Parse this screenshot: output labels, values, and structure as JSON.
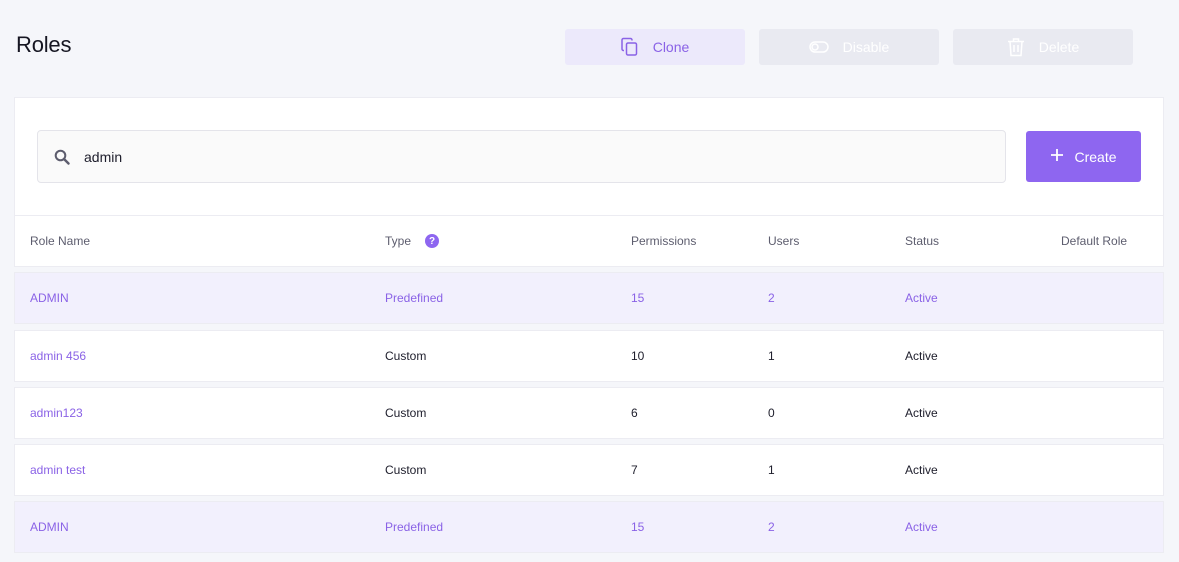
{
  "page": {
    "title": "Roles"
  },
  "actions": {
    "clone_label": "Clone",
    "disable_label": "Disable",
    "delete_label": "Delete"
  },
  "search": {
    "value": "admin",
    "icon": "search-icon"
  },
  "create": {
    "label": "Create",
    "icon": "plus-icon"
  },
  "colors": {
    "accent": "#8e66f0",
    "accent_text": "#8a62e6",
    "highlight_row": "#f2f0fd",
    "disabled_button": "#e9eaf1"
  },
  "table": {
    "headers": {
      "role_name": "Role Name",
      "type": "Type",
      "type_help": "?",
      "permissions": "Permissions",
      "users": "Users",
      "status": "Status",
      "default_role": "Default Role"
    },
    "rows": [
      {
        "name": "ADMIN",
        "type": "Predefined",
        "permissions": "15",
        "users": "2",
        "status": "Active",
        "highlighted": true
      },
      {
        "name": "admin 456",
        "type": "Custom",
        "permissions": "10",
        "users": "1",
        "status": "Active",
        "highlighted": false
      },
      {
        "name": "admin123",
        "type": "Custom",
        "permissions": "6",
        "users": "0",
        "status": "Active",
        "highlighted": false
      },
      {
        "name": "admin test",
        "type": "Custom",
        "permissions": "7",
        "users": "1",
        "status": "Active",
        "highlighted": false
      },
      {
        "name": "ADMIN",
        "type": "Predefined",
        "permissions": "15",
        "users": "2",
        "status": "Active",
        "highlighted": true
      }
    ]
  }
}
